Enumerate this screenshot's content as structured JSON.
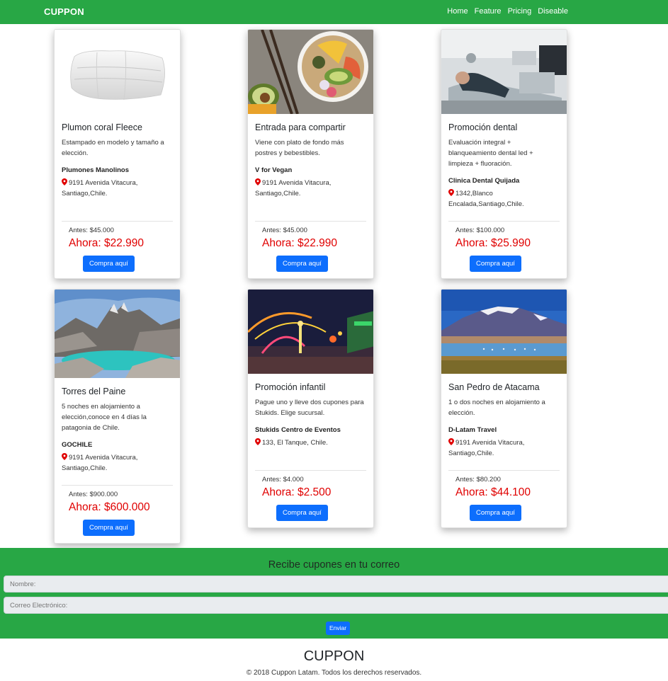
{
  "nav": {
    "brand": "CUPPON",
    "links": [
      "Home",
      "Feature",
      "Pricing",
      "Diseable"
    ]
  },
  "cards": [
    {
      "image": "duvet-icon",
      "title": "Plumon coral Fleece",
      "description": "Estampado en modelo y tamaño a elección.",
      "business": "Plumones Manolinos",
      "address": "9191 Avenida Vitacura, Santiago,Chile.",
      "price_before": "Antes: $45.000",
      "price_now": "Ahora: $22.990",
      "button": "Compra aquí"
    },
    {
      "image": "food-bowl-icon",
      "title": "Entrada para compartir",
      "description": "Viene con plato de fondo más postres y bebestibles.",
      "business": "V for Vegan",
      "address": "9191 Avenida Vitacura, Santiago,Chile.",
      "price_before": "Antes: $45.000",
      "price_now": "Ahora: $22.990",
      "button": "Compra aquí"
    },
    {
      "image": "dental-chair-icon",
      "title": "Promoción dental",
      "description": "Evaluación integral + blanqueamiento dental led + limpieza + fluoración.",
      "business": "Clinica Dental Quijada",
      "address": "1342,Blanco Encalada,Santiago,Chile.",
      "price_before": "Antes: $100.000",
      "price_now": "Ahora: $25.990",
      "button": "Compra aquí"
    },
    {
      "image": "mountains-lake-icon",
      "title": "Torres del Paine",
      "description": "5 noches en alojamiento a elección,conoce en 4 días la patagonia de Chile.",
      "business": "GOCHILE",
      "address": "9191 Avenida Vitacura, Santiago,Chile.",
      "price_before": "Antes: $900.000",
      "price_now": "Ahora: $600.000",
      "button": "Compra aquí"
    },
    {
      "image": "carnival-lights-icon",
      "title": "Promoción infantil",
      "description": "Pague uno y lleve dos cupones para Stukids. Elige sucursal.",
      "business": "Stukids Centro de Eventos",
      "address": "133, El Tanque, Chile.",
      "price_before": "Antes: $4.000",
      "price_now": "Ahora: $2.500",
      "button": "Compra aquí"
    },
    {
      "image": "desert-lagoon-icon",
      "title": "San Pedro de Atacama",
      "description": "1 o dos noches en alojamiento a elección.",
      "business": "D-Latam Travel",
      "address": "9191 Avenida Vitacura, Santiago,Chile.",
      "price_before": "Antes: $80.200",
      "price_now": "Ahora: $44.100",
      "button": "Compra aquí"
    }
  ],
  "newsletter": {
    "title": "Recibe cupones en tu correo",
    "name_placeholder": "Nombre:",
    "email_placeholder": "Correo Electrónico:",
    "submit": "Enviar"
  },
  "footer": {
    "brand": "CUPPON",
    "copyright": "© 2018 Cuppon Latam. Todos los derechos reservados."
  },
  "colors": {
    "green": "#28a745",
    "button_blue": "#0d6efd",
    "price_red": "#e00000"
  }
}
